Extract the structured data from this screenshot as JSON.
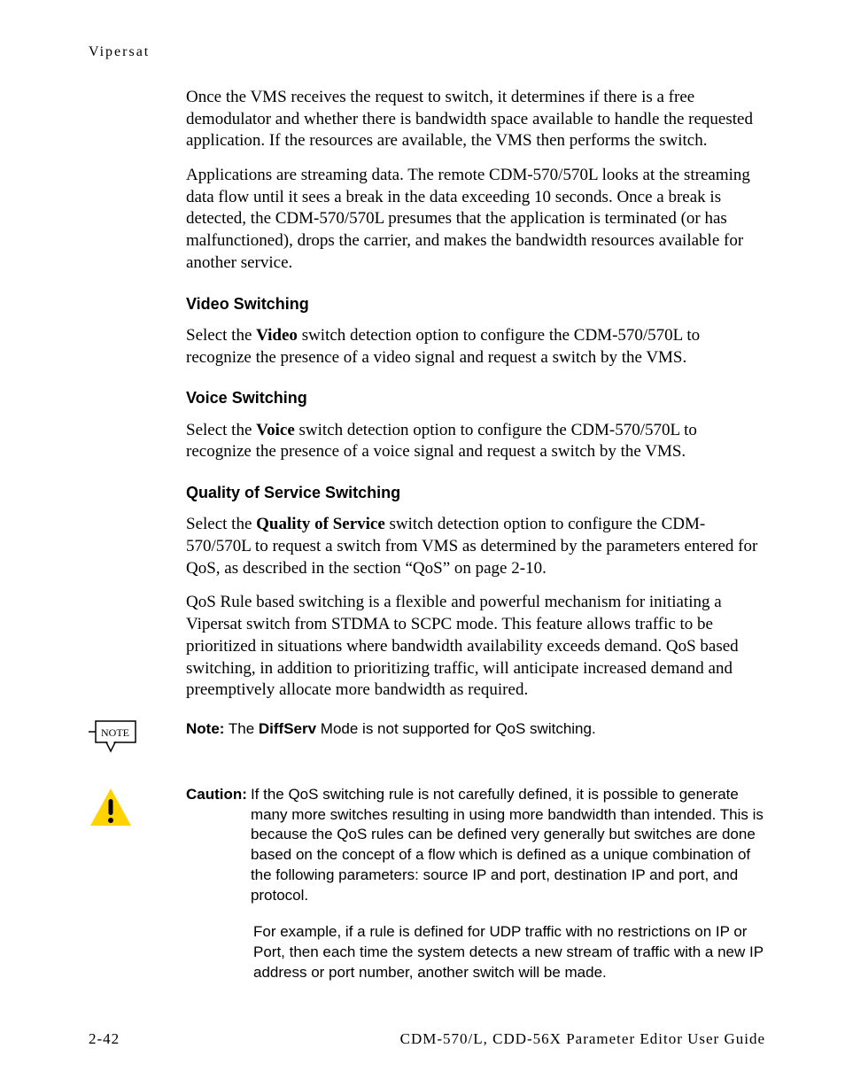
{
  "header": "Vipersat",
  "p1": "Once the VMS receives the request to switch, it determines if there is a free demodulator and whether there is bandwidth space available to handle the requested application. If the resources are available, the VMS then performs the switch.",
  "p2": "Applications are streaming data. The remote CDM-570/570L looks at the streaming data flow until it sees a break in the data exceeding 10 seconds. Once a break is detected, the CDM-570/570L presumes that the application is terminated (or has malfunctioned), drops the carrier, and makes the bandwidth resources available for another service.",
  "h_video": "Video Switching",
  "video_prefix": "Select the ",
  "video_bold": "Video",
  "video_suffix": " switch detection option to configure the CDM-570/570L to recognize the presence of a video signal and request a switch by the VMS.",
  "h_voice": "Voice Switching",
  "voice_prefix": "Select the ",
  "voice_bold": "Voice",
  "voice_suffix": " switch detection option to configure the CDM-570/570L to recognize the presence of a voice signal and request a switch by the VMS.",
  "h_qos": "Quality of Service Switching",
  "qos_prefix": "Select the ",
  "qos_bold": "Quality of Service",
  "qos_suffix": " switch detection option to configure the CDM-570/570L to request a switch from VMS as determined by the parameters entered for QoS, as described in the section “QoS” on page 2-10.",
  "qos_p2": "QoS Rule based switching is a flexible and powerful mechanism for initiating a Vipersat switch from STDMA to SCPC mode. This feature allows traffic to be prioritized in situations where bandwidth availability exceeds demand. QoS based switching, in addition to prioritizing traffic, will anticipate increased demand and preemptively allocate more bandwidth as required.",
  "note_label": "Note:",
  "note_prefix": "  The ",
  "note_bold": "DiffServ",
  "note_suffix": " Mode is not supported for QoS switching.",
  "note_icon_label": "NOTE",
  "caution_label": "Caution:",
  "caution_p1": "  If the QoS switching rule is not carefully defined, it is possible to generate many more switches resulting in using more bandwidth than intended. This is because the QoS rules can be defined very generally but switches are done based on the concept of a flow which is defined as a unique combination of the following parameters: source IP and port, destination IP and port, and protocol.",
  "caution_p2": "For example, if a rule is defined for UDP traffic with no restrictions on IP or Port, then each time the system detects a new stream of traffic with a new IP address or port number, another switch will be made.",
  "footer_left": "2-42",
  "footer_right": "CDM-570/L, CDD-56X Parameter Editor User Guide"
}
